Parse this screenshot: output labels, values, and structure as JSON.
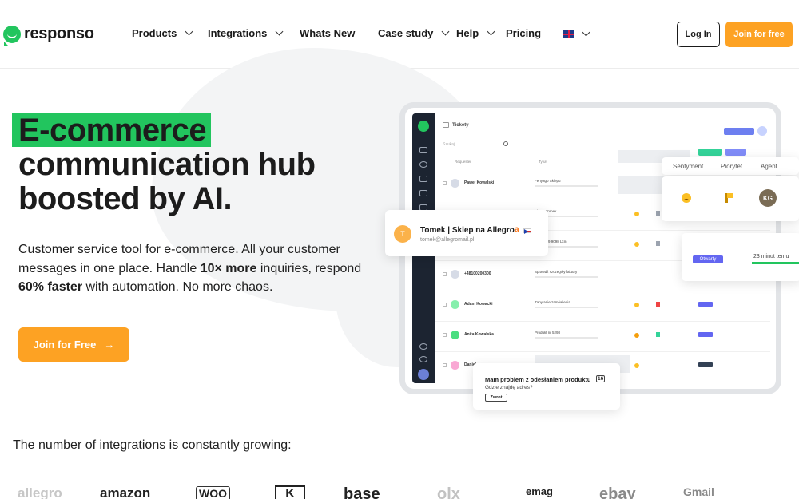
{
  "nav": {
    "brand": "responso",
    "items": [
      {
        "label": "Products",
        "dropdown": true
      },
      {
        "label": "Integrations",
        "dropdown": true
      },
      {
        "label": "Whats New",
        "dropdown": false
      },
      {
        "label": "Case study",
        "dropdown": true
      },
      {
        "label": "Help",
        "dropdown": true
      },
      {
        "label": "Pricing",
        "dropdown": false
      }
    ],
    "login_label": "Log In",
    "join_label": "Join for free"
  },
  "hero": {
    "highlight": "E-commerce",
    "title_line2": "communication hub",
    "title_line3": "boosted by AI.",
    "desc_part1": "Customer service tool for e-commerce. All your customer messages in one place. Handle ",
    "desc_bold1": "10× more",
    "desc_part2": " inquiries, respond ",
    "desc_bold2": "60% faster",
    "desc_part3": " with automation. No more chaos.",
    "cta_label": "Join for Free",
    "cta_arrow": "→"
  },
  "mock": {
    "screen_title": "Tickety",
    "search_placeholder": "Szukaj",
    "col_requester": "Requester",
    "col_title": "Tytuł",
    "rows": [
      {
        "name": "Paweł Kowalski",
        "subject": "Fenyago Sklepu"
      },
      {
        "name": "",
        "subject": "Chat z Tomek"
      },
      {
        "name": "",
        "subject": "RE: Re: 9 9098 Lcm"
      },
      {
        "name": "+48100200300",
        "subject": "Sprawdź szczegóły faktury"
      },
      {
        "name": "Adam Kowacki",
        "subject": "Zapytanie zamówienia"
      },
      {
        "name": "Anita Kowalska",
        "subject": "Produkt nr 5298"
      },
      {
        "name": "Daniel",
        "subject": ""
      }
    ]
  },
  "card_tomek": {
    "initial": "T",
    "name": "Tomek | Sklep na Allegro",
    "email": "tomek@allegromail.pl",
    "marketplace_glyph": "a"
  },
  "card_columns": {
    "col1": "Sentyment",
    "col2": "Piorytet",
    "col3": "Agent",
    "agent_initials": "KG"
  },
  "card_status": {
    "badge": "Otwarty",
    "time": "23 minut temu"
  },
  "card_msg": {
    "title": "Mam problem z odesłaniem produktu",
    "count": "16",
    "subtitle": "Gdzie znajdę adres?",
    "button": "Zwrot"
  },
  "integrations": {
    "title": "The number of integrations is constantly growing:",
    "logos": [
      "allegro",
      "amazon",
      "WOO",
      "K",
      "base",
      "olx",
      "emag",
      "ebay",
      "Gmail"
    ]
  },
  "colors": {
    "accent_orange": "#fda223",
    "brand_green": "#22c55e",
    "ink": "#1c1c1c"
  }
}
